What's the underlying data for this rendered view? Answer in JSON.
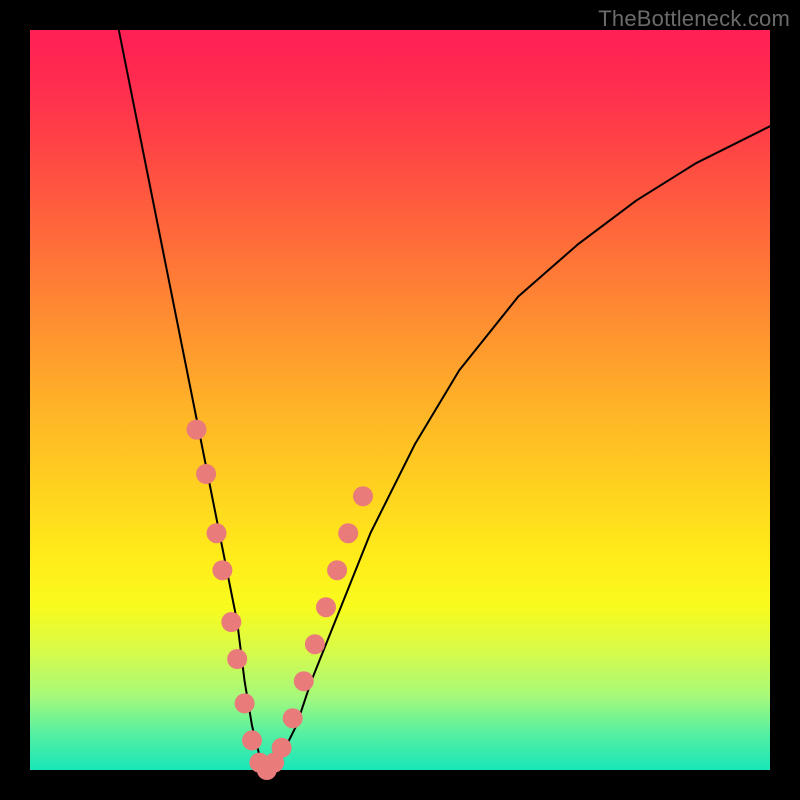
{
  "watermark": "TheBottleneck.com",
  "chart_data": {
    "type": "line",
    "title": "",
    "xlabel": "",
    "ylabel": "",
    "xlim": [
      0,
      100
    ],
    "ylim": [
      0,
      100
    ],
    "series": [
      {
        "name": "bottleneck-curve",
        "x": [
          12,
          14,
          16,
          18,
          20,
          22,
          24,
          26,
          28,
          29,
          30,
          31,
          32,
          34,
          36,
          38,
          42,
          46,
          52,
          58,
          66,
          74,
          82,
          90,
          100
        ],
        "y": [
          100,
          90,
          80,
          70,
          60,
          50,
          40,
          30,
          20,
          12,
          6,
          2,
          0,
          2,
          6,
          12,
          22,
          32,
          44,
          54,
          64,
          71,
          77,
          82,
          87
        ]
      }
    ],
    "markers": {
      "name": "highlight-dots",
      "color": "#e97b7b",
      "points": [
        {
          "x": 22.5,
          "y": 46
        },
        {
          "x": 23.8,
          "y": 40
        },
        {
          "x": 25.2,
          "y": 32
        },
        {
          "x": 26.0,
          "y": 27
        },
        {
          "x": 27.2,
          "y": 20
        },
        {
          "x": 28.0,
          "y": 15
        },
        {
          "x": 29.0,
          "y": 9
        },
        {
          "x": 30.0,
          "y": 4
        },
        {
          "x": 31.0,
          "y": 1
        },
        {
          "x": 32.0,
          "y": 0
        },
        {
          "x": 33.0,
          "y": 1
        },
        {
          "x": 34.0,
          "y": 3
        },
        {
          "x": 35.5,
          "y": 7
        },
        {
          "x": 37.0,
          "y": 12
        },
        {
          "x": 38.5,
          "y": 17
        },
        {
          "x": 40.0,
          "y": 22
        },
        {
          "x": 41.5,
          "y": 27
        },
        {
          "x": 43.0,
          "y": 32
        },
        {
          "x": 45.0,
          "y": 37
        }
      ]
    }
  }
}
